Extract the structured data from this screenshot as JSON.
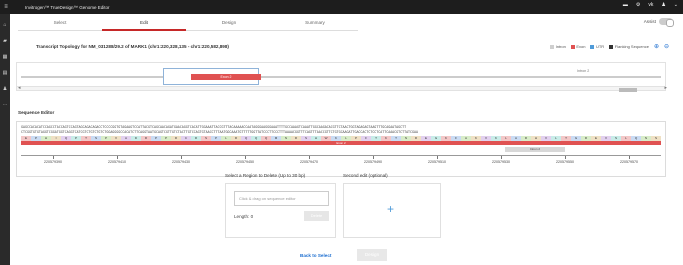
{
  "app": {
    "title": "Invitrogen™ TrueDesign™ Genome Editor",
    "user_initials": "vk"
  },
  "tabs": [
    {
      "label": "Select"
    },
    {
      "label": "Edit"
    },
    {
      "label": "Design"
    },
    {
      "label": "Summary"
    }
  ],
  "assist_label": "Assist",
  "topology": {
    "title": "Transcript Topology for NM_031288/29.2 of MARK1 (chr1:220,328,135 - chr1:220,582,898)",
    "exon_label": "Exon 2",
    "intron_label": "Intron 2"
  },
  "legend": [
    {
      "label": "Intron",
      "color": "#cfcfcf"
    },
    {
      "label": "Exon",
      "color": "#e05252"
    },
    {
      "label": "UTR",
      "color": "#4f9bd9"
    },
    {
      "label": "Flanking Sequence",
      "color": "#333333"
    }
  ],
  "sequence_editor": {
    "title": "Sequence Editor",
    "seq_top": "GAGCCACACATCCAGCCTACCAGTCCAGTAGCAGACAGACCTCCCCGGTGTAGAAGTCCATTACGTCAGCAACAGATGAACAGGTCACATTGGAAATTACCGTTTACAAAAACCAATAGGGAAGGGAAATTTTGCCAAAGTCAAATTGGCAAGACACGTTCTAACTGGTAGAGAGTAAGTTTGCAGAATAGCTT",
    "seq_bottom": "CTCGGTGTGTAGGTCGGATGGTCAGGTCATCGTCTGTCTGTCTGGAGGGGCCACATCTTCAGGTAATGCAGTCGTTGTCTACTTGTCCAGTGTAACCTTTAATGGCAAATGTTTTTGGTTATCCCTTCCCTTTAAAACGGTTTCAGTTTAACCGTTCTGTGCAAGATTGACCACTCTCCTCATTCAAACGTCTTATCGAA",
    "amino_acids": [
      "E",
      "P",
      "H",
      "I",
      "Q",
      "P",
      "T",
      "S",
      "P",
      "V",
      "A",
      "D",
      "R",
      "P",
      "P",
      "R",
      "C",
      "R",
      "S",
      "P",
      "L",
      "R",
      "Q",
      "Q",
      "Q",
      "M",
      "N",
      "R",
      "S",
      "H",
      "W",
      "K",
      "L",
      "P",
      "F",
      "T",
      "K",
      "T",
      "N",
      "R",
      "E",
      "G",
      "K",
      "F",
      "A",
      "K",
      "V",
      "K",
      "L",
      "A",
      "R",
      "H",
      "V",
      "L",
      "T",
      "G",
      "R",
      "E",
      "V",
      "S",
      "L",
      "Q",
      "N",
      "S"
    ],
    "exon_label": "Exon 2",
    "intron_label": "Intron 2",
    "ticks": [
      "220579390",
      "220579410",
      "220579430",
      "220579450",
      "220579470",
      "220579490",
      "220579510",
      "220579530",
      "220579550",
      "220579570"
    ]
  },
  "delete_region": {
    "title": "Select a Region to Delete (Up to 30 bp)",
    "placeholder": "Click & drag on sequence editor",
    "length_label": "Length: 0",
    "delete_button": "Delete"
  },
  "second_edit": {
    "title": "Second edit (optional)",
    "plus": "+"
  },
  "footer": {
    "back_label": "Back to Select",
    "design_label": "Design"
  }
}
